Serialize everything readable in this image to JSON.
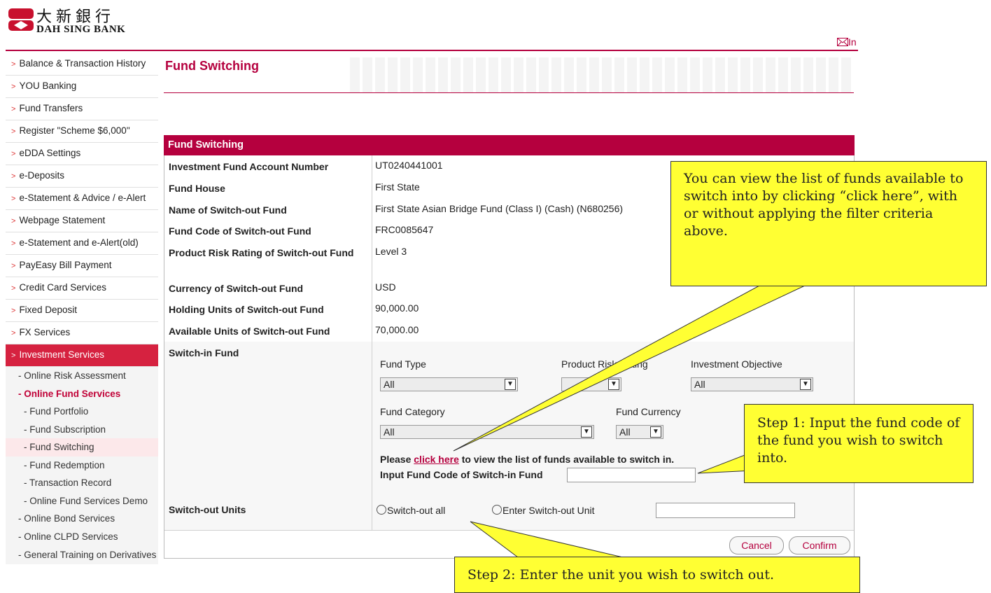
{
  "header": {
    "logo_chinese": "大新銀行",
    "logo_english": "DAH SING BANK",
    "inbox_label": "In"
  },
  "sidebar": {
    "items": [
      {
        "label": "Balance & Transaction History"
      },
      {
        "label": "YOU Banking"
      },
      {
        "label": "Fund Transfers"
      },
      {
        "label": "Register \"Scheme $6,000\""
      },
      {
        "label": "eDDA Settings"
      },
      {
        "label": "e-Deposits"
      },
      {
        "label": "e-Statement & Advice / e-Alert"
      },
      {
        "label": "Webpage Statement"
      },
      {
        "label": "e-Statement and e-Alert(old)"
      },
      {
        "label": "PayEasy Bill Payment"
      },
      {
        "label": "Credit Card Services"
      },
      {
        "label": "Fixed Deposit"
      },
      {
        "label": "FX Services"
      },
      {
        "label": "Investment Services"
      }
    ],
    "sub_items": [
      {
        "label": "- Online Risk Assessment"
      },
      {
        "label": "- Online Fund Services"
      },
      {
        "label": "- Fund Portfolio"
      },
      {
        "label": "- Fund Subscription"
      },
      {
        "label": "- Fund Switching"
      },
      {
        "label": "- Fund Redemption"
      },
      {
        "label": "- Transaction Record"
      },
      {
        "label": "- Online Fund Services Demo"
      },
      {
        "label": "- Online Bond Services"
      },
      {
        "label": "- Online CLPD Services"
      },
      {
        "label": "- General Training on Derivatives"
      }
    ]
  },
  "page": {
    "title": "Fund Switching",
    "panel_title": "Fund Switching"
  },
  "details": [
    {
      "label": "Investment Fund Account Number",
      "value": "UT0240441001"
    },
    {
      "label": "Fund House",
      "value": "First State"
    },
    {
      "label": "Name of Switch-out Fund",
      "value": "First State Asian Bridge Fund (Class I) (Cash) (N680256)"
    },
    {
      "label": "Fund Code of Switch-out Fund",
      "value": "FRC0085647"
    },
    {
      "label": "Product Risk Rating of Switch-out Fund",
      "value": "Level 3"
    },
    {
      "label": "Currency of Switch-out Fund",
      "value": "USD"
    },
    {
      "label": "Holding Units of Switch-out Fund",
      "value": "90,000.00"
    },
    {
      "label": "Available Units of Switch-out Fund",
      "value": "70,000.00"
    }
  ],
  "switch_in": {
    "label": "Switch-in Fund",
    "fund_type_label": "Fund Type",
    "fund_type_value": "All",
    "product_risk_label": "Product Risk Rating",
    "investment_objective_label": "Investment Objective",
    "investment_objective_value": "All",
    "fund_category_label": "Fund Category",
    "fund_category_value": "All",
    "fund_currency_label": "Fund Currency",
    "fund_currency_value": "All",
    "please_text": "Please",
    "click_here": "click here",
    "view_list_text": "to view the list of funds available to switch in.",
    "input_code_label": "Input Fund Code of Switch-in Fund"
  },
  "switch_out": {
    "label": "Switch-out Units",
    "option_all": "Switch-out all",
    "option_enter": "Enter Switch-out Unit"
  },
  "buttons": {
    "cancel": "Cancel",
    "confirm": "Confirm"
  },
  "callouts": {
    "click_here_tip": "You can view the list of funds available to switch into by clicking “click here”, with or without applying the filter criteria above.",
    "step1": "Step 1: Input the fund code of the fund you wish to switch into.",
    "step2": "Step 2: Enter the unit you wish to switch out."
  },
  "colors": {
    "brand": "#b5003e",
    "active_nav": "#d62240",
    "callout": "#ffff33"
  }
}
